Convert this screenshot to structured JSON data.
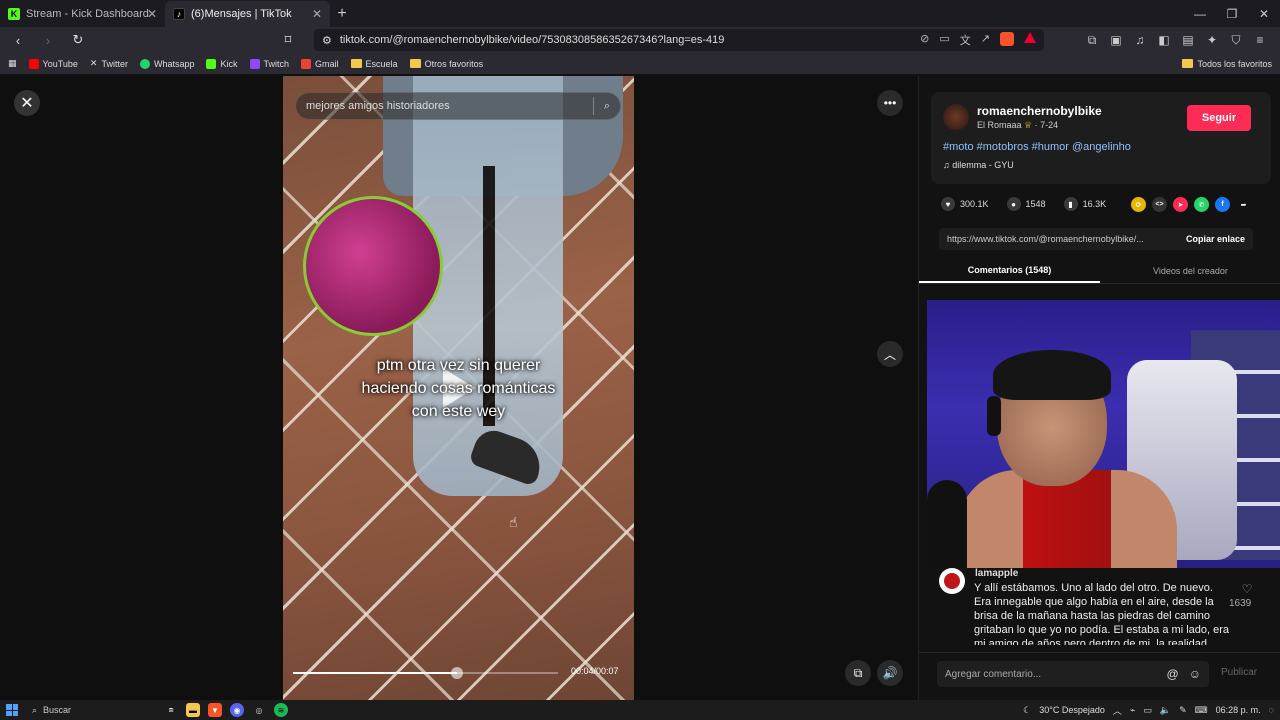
{
  "browser": {
    "tabs": [
      {
        "label": "Stream - Kick Dashboard",
        "icon": "kick-icon"
      },
      {
        "label": "(6)Mensajes | TikTok",
        "icon": "tiktok-icon"
      }
    ],
    "url": "tiktok.com/@romaenchernobylbike/video/7530830858635267346?lang=es-419",
    "bookmarks": [
      "YouTube",
      "Twitter",
      "Whatsapp",
      "Kick",
      "Twitch",
      "Gmail",
      "Escuela",
      "Otros favoritos"
    ],
    "all_bookmarks": "Todos los favoritos"
  },
  "video": {
    "search_placeholder": "mejores amigos historiadores",
    "caption_line1": "ptm otra vez sin querer",
    "caption_line2": "haciendo cosas románticas",
    "caption_line3": "con este wey",
    "time": "00:04/00:07",
    "progress": 0.62
  },
  "panel": {
    "username": "romaenchernobylbike",
    "display_name": "El Romaaa",
    "date": "7-24",
    "follow_label": "Seguir",
    "hashtags": "#moto #motobros #humor @angelinho",
    "music": "dilemma - GYU",
    "likes": "300.1K",
    "comments": "1548",
    "saves": "16.3K",
    "link": "https://www.tiktok.com/@romaenchernobylbike/...",
    "copy_link": "Copiar enlace",
    "tab_comments": "Comentarios (1548)",
    "tab_creator": "Videos del creador"
  },
  "comment": {
    "user": "lamapple",
    "text": "Y allí estábamos. Uno al lado del otro. De nuevo. Era innegable que algo había en el aire, desde la brisa de la mañana hasta las piedras del camino gritaban lo que yo no podía. El estaba a mi lado, era mi amigo de años pero dentro de mi, la realidad",
    "likes": "1639"
  },
  "comment_bar": {
    "placeholder": "Agregar comentario...",
    "publish": "Publicar"
  },
  "taskbar": {
    "search": "Buscar",
    "weather": "30°C Despejado",
    "time": "06:28 p. m."
  },
  "colors": {
    "follow": "#fe2c55",
    "hashtag": "#8fc1ff"
  }
}
